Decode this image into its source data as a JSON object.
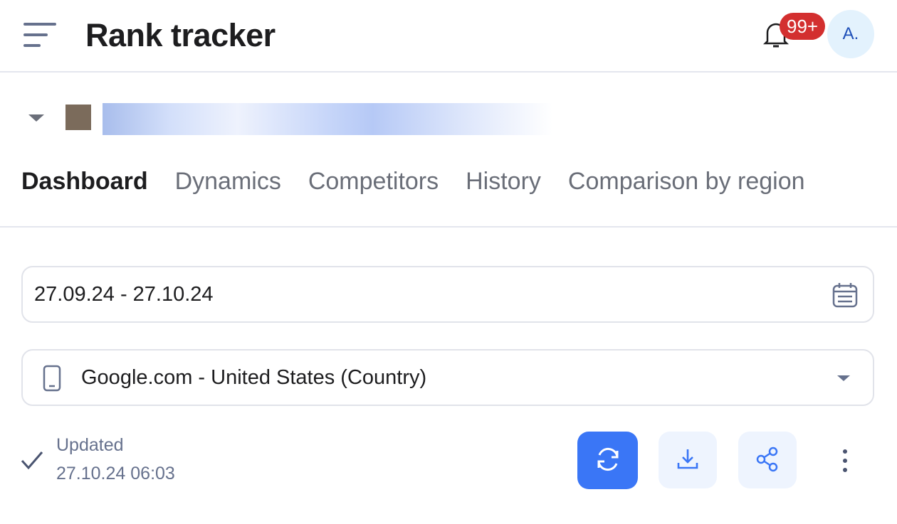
{
  "header": {
    "title": "Rank tracker",
    "notifications_badge": "99+",
    "avatar_initials": "A.",
    "menu_icon": "hamburger-icon",
    "bell_icon": "bell-icon"
  },
  "project": {
    "icon": "chevron-down-icon"
  },
  "tabs": [
    {
      "label": "Dashboard",
      "active": true
    },
    {
      "label": "Dynamics"
    },
    {
      "label": "Competitors"
    },
    {
      "label": "History"
    },
    {
      "label": "Comparison by region"
    }
  ],
  "filters": {
    "date_range": "27.09.24 - 27.10.24",
    "date_icon": "calendar-icon",
    "region": "Google.com - United States (Country)",
    "region_icon": "mobile-icon"
  },
  "status": {
    "label": "Updated",
    "time": "27.10.24 06:03"
  },
  "actions": {
    "refresh_icon": "refresh-icon",
    "download_icon": "download-icon",
    "share_icon": "share-icon",
    "more_icon": "more-vertical-icon"
  },
  "colors": {
    "accent": "#3a76f6",
    "badge": "#d32f2f",
    "avatar_bg": "#e3f2fd"
  }
}
